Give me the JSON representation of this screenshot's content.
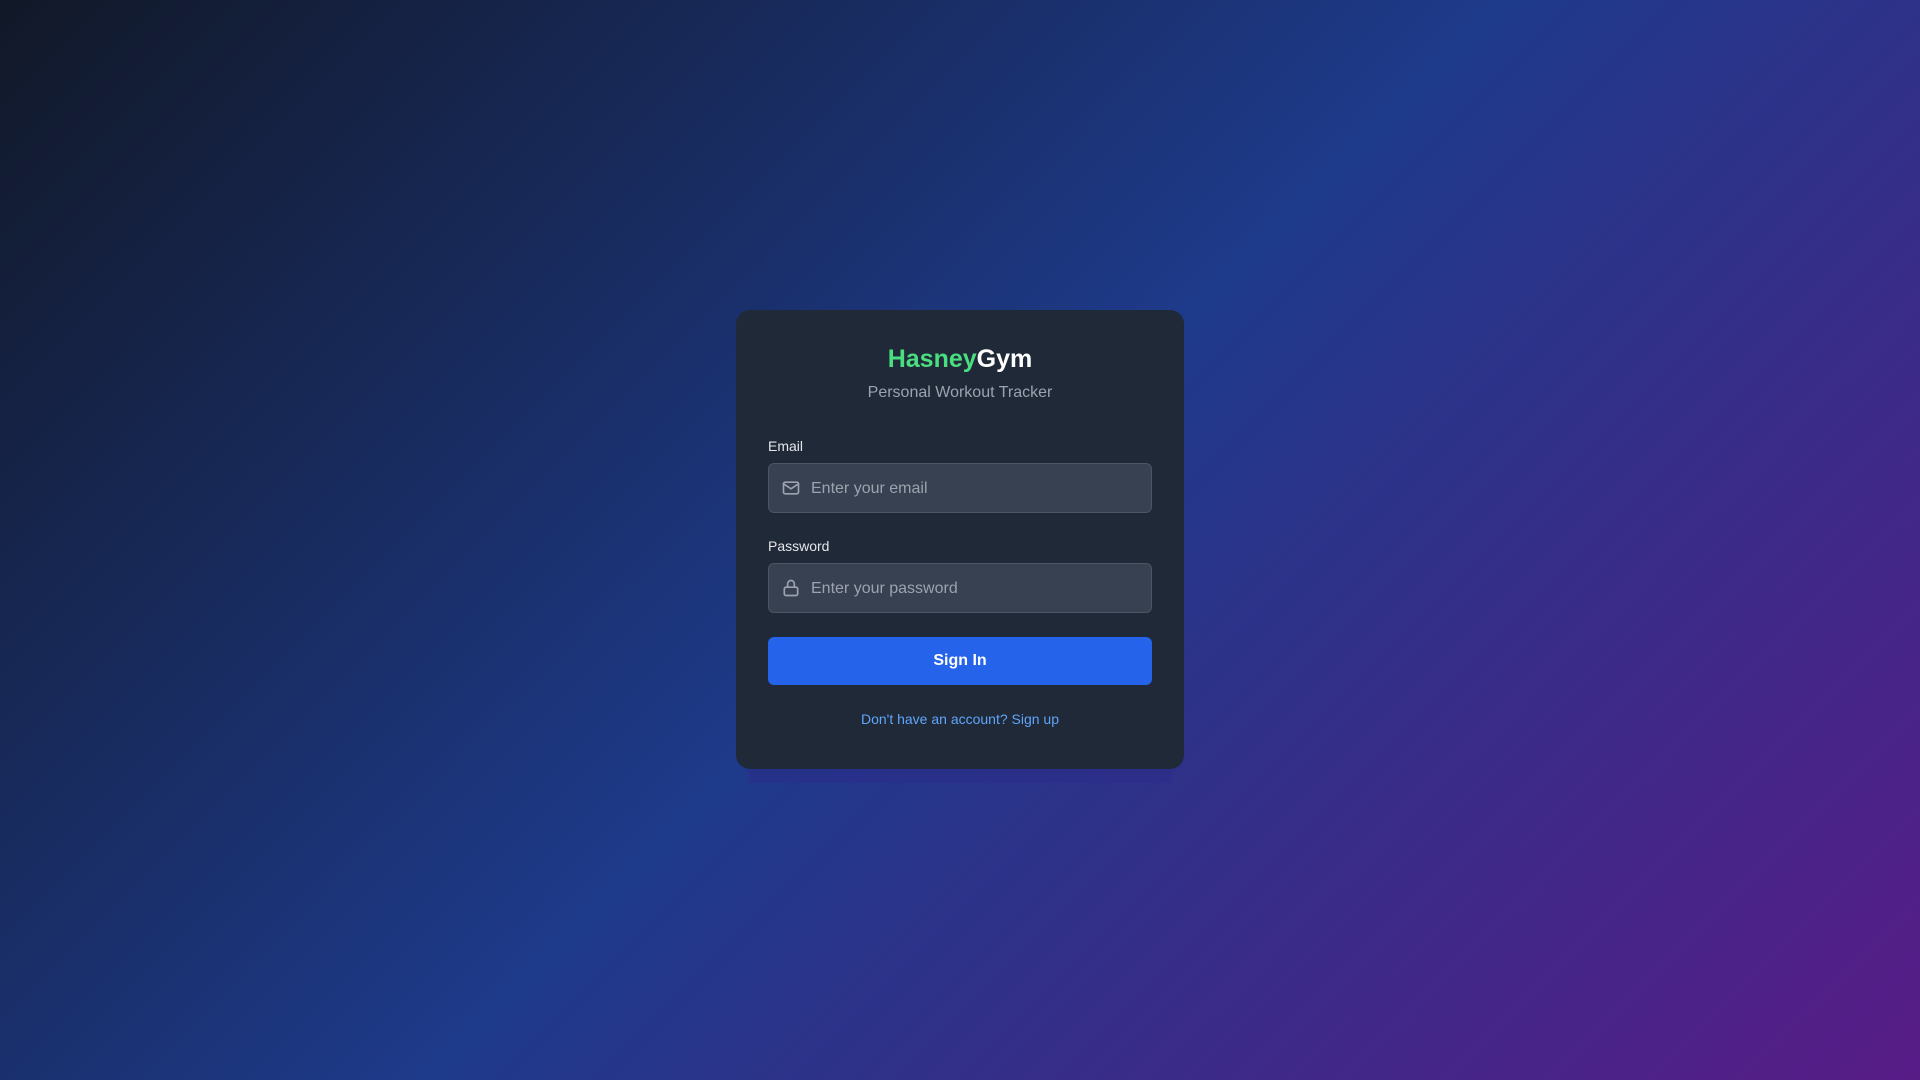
{
  "brand": {
    "name_part1": "Hasney",
    "name_part2": "Gym",
    "subtitle": "Personal Workout Tracker"
  },
  "form": {
    "email_label": "Email",
    "email_placeholder": "Enter your email",
    "email_value": "",
    "email_icon": "mail-icon",
    "password_label": "Password",
    "password_placeholder": "Enter your password",
    "password_value": "",
    "password_icon": "lock-icon",
    "submit_label": "Sign In",
    "signup_link": "Don't have an account? Sign up"
  },
  "colors": {
    "brand_accent": "#4ade80",
    "primary_button": "#2563eb",
    "link": "#60a5fa",
    "card_bg": "#1f2937"
  }
}
